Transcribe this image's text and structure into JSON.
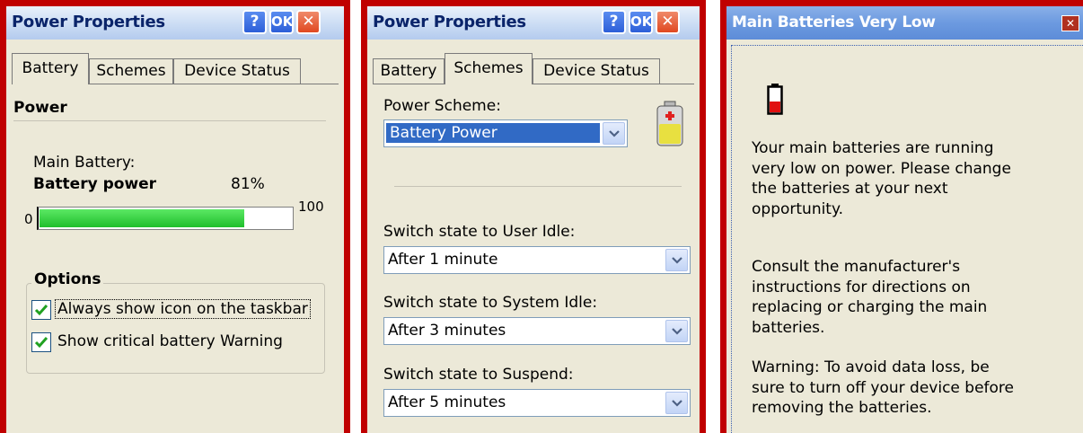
{
  "panel1": {
    "title": "Power Properties",
    "help_label": "?",
    "ok_label": "OK",
    "close_label": "✕",
    "tabs": [
      "Battery",
      "Schemes",
      "Device Status"
    ],
    "power_heading": "Power",
    "main_battery_label": "Main Battery:",
    "battery_status": "Battery power",
    "battery_percent": "81%",
    "battery_level": 0.81,
    "scale_min": "0",
    "scale_max": "100",
    "options_heading": "Options",
    "option_taskbar": "Always show icon on the taskbar",
    "option_taskbar_checked": true,
    "option_warning": "Show critical battery Warning",
    "option_warning_checked": true
  },
  "panel2": {
    "title": "Power Properties",
    "help_label": "?",
    "ok_label": "OK",
    "close_label": "✕",
    "tabs": [
      "Battery",
      "Schemes",
      "Device Status"
    ],
    "scheme_label": "Power Scheme:",
    "scheme_value": "Battery Power",
    "user_idle_label": "Switch state to User Idle:",
    "user_idle_value": "After 1 minute",
    "system_idle_label": "Switch state to System Idle:",
    "system_idle_value": "After 3 minutes",
    "suspend_label": "Switch state to Suspend:",
    "suspend_value": "After 5 minutes"
  },
  "panel3": {
    "title": "Main Batteries Very Low",
    "close_label": "✕",
    "para1": [
      "Your main batteries are running",
      "very low on power. Please change",
      "the batteries at your next",
      "opportunity."
    ],
    "para2": [
      "Consult the manufacturer's",
      "instructions for directions on",
      "replacing or charging the main",
      "batteries."
    ],
    "para3": [
      "Warning: To avoid data loss, be",
      "sure to turn off your device before",
      "removing the batteries."
    ]
  },
  "colors": {
    "frame_red": "#c00000",
    "dialog_bg": "#ece9d8",
    "title_text": "#0a246a",
    "selection": "#316ac5",
    "progress_green": "#2bd13a"
  }
}
